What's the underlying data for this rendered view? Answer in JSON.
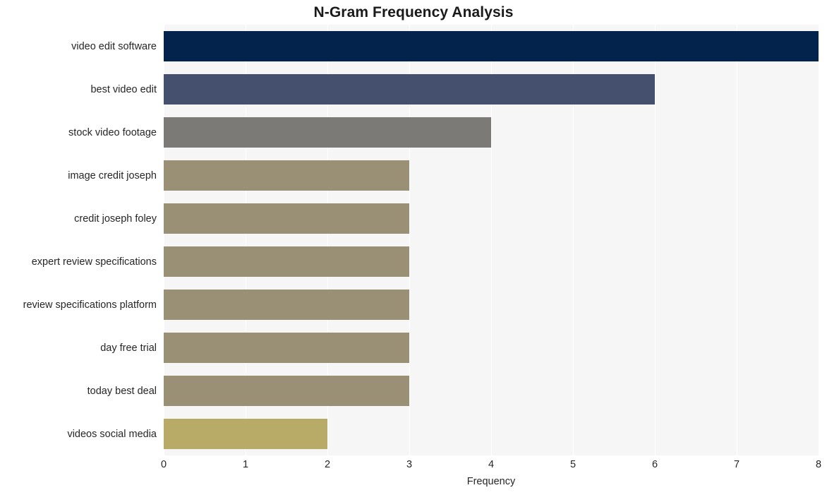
{
  "chart_data": {
    "type": "bar",
    "orientation": "horizontal",
    "title": "N-Gram Frequency Analysis",
    "xlabel": "Frequency",
    "ylabel": "",
    "xlim": [
      0,
      8
    ],
    "xticks": [
      "0",
      "1",
      "2",
      "3",
      "4",
      "5",
      "6",
      "7",
      "8"
    ],
    "grid": true,
    "legend": "none",
    "categories": [
      "video edit software",
      "best video edit",
      "stock video footage",
      "image credit joseph",
      "credit joseph foley",
      "expert review specifications",
      "review specifications platform",
      "day free trial",
      "today best deal",
      "videos social media"
    ],
    "values": [
      8,
      6,
      4,
      3,
      3,
      3,
      3,
      3,
      3,
      2
    ],
    "bar_colors": [
      "#03224c",
      "#454f6e",
      "#7b7a77",
      "#999075",
      "#999075",
      "#999075",
      "#999075",
      "#999075",
      "#999075",
      "#b8ab68"
    ],
    "plot_background": "#f6f6f7",
    "gridline_color": "#ffffff",
    "figure_background": "#ffffff"
  }
}
